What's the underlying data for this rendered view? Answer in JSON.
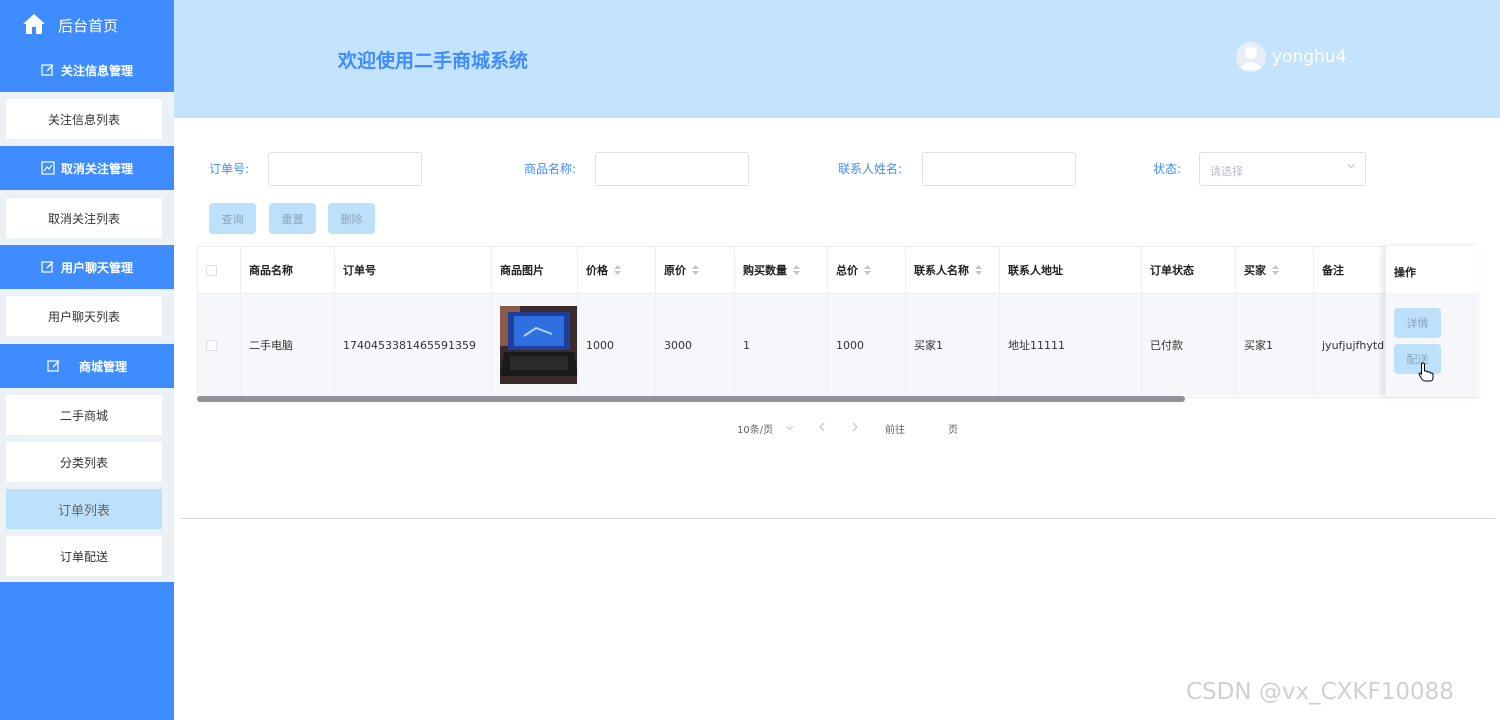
{
  "sidebar": {
    "home_label": "后台首页",
    "groups": [
      {
        "title": "关注信息管理",
        "items": [
          "关注信息列表"
        ]
      },
      {
        "title": "取消关注管理",
        "items": [
          "取消关注列表"
        ]
      },
      {
        "title": "用户聊天管理",
        "items": [
          "用户聊天列表"
        ]
      },
      {
        "title": "商城管理",
        "items": [
          "二手商城",
          "分类列表",
          "订单列表",
          "订单配送"
        ]
      }
    ],
    "active_item": "订单列表"
  },
  "header": {
    "title": "欢迎使用二手商城系统",
    "username": "yonghu4"
  },
  "search": {
    "order_no_label": "订单号:",
    "product_name_label": "商品名称:",
    "contact_name_label": "联系人姓名:",
    "status_label": "状态:",
    "status_placeholder": "请选择"
  },
  "actions": {
    "query": "查询",
    "reset": "重置",
    "delete": "删除"
  },
  "table": {
    "columns": [
      "商品名称",
      "订单号",
      "商品图片",
      "价格",
      "原价",
      "购买数量",
      "总价",
      "联系人名称",
      "联系人地址",
      "订单状态",
      "买家",
      "备注",
      "操作"
    ],
    "rows": [
      {
        "product_name": "二手电脑",
        "order_no": "1740453381465591359",
        "price": "1000",
        "original_price": "3000",
        "quantity": "1",
        "total": "1000",
        "contact_name": "买家1",
        "contact_address": "地址11111",
        "status": "已付款",
        "buyer": "买家1",
        "remark": "jyufjujfhytd"
      }
    ],
    "row_actions": {
      "detail": "详情",
      "deliver": "配送"
    }
  },
  "pagination": {
    "page_size": "10条/页",
    "goto_prefix": "前往",
    "goto_suffix": "页"
  },
  "watermark": "CSDN @vx_CXKF10088",
  "colors": {
    "primary": "#3f8cff",
    "header_bg": "#c4e4fd",
    "button_bg": "#bde0fb"
  }
}
